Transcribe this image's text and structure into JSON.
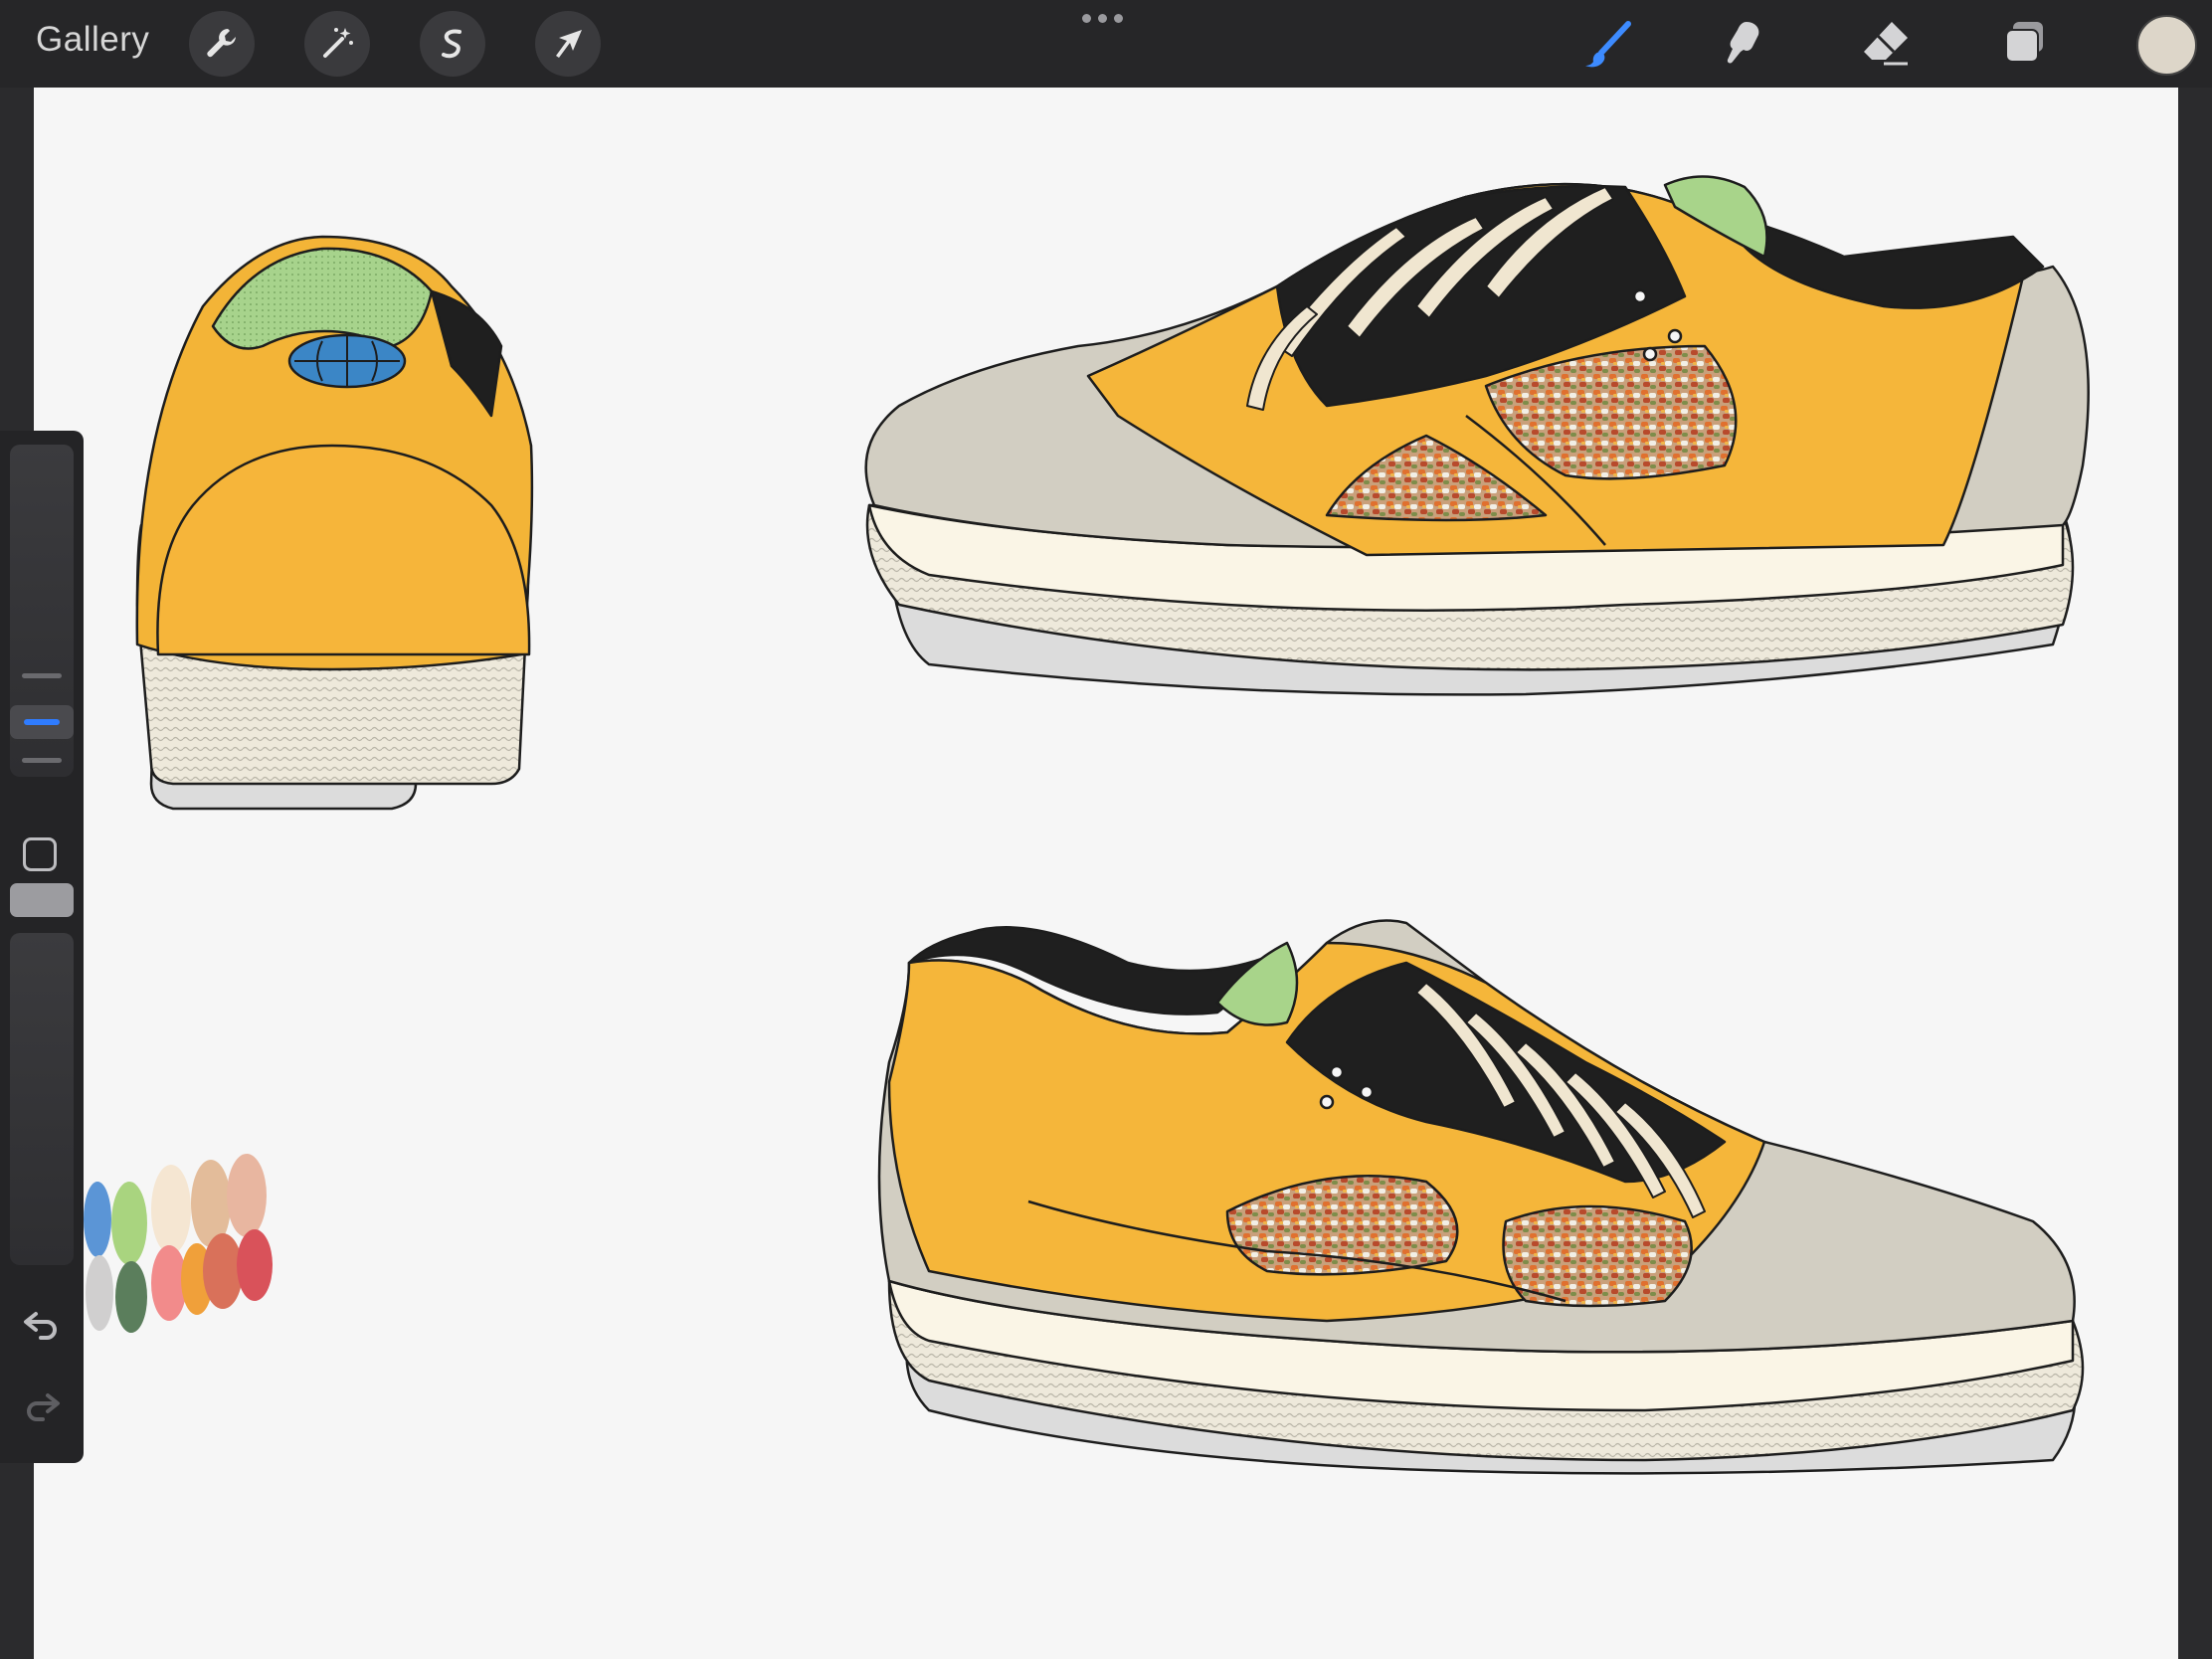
{
  "topbar": {
    "gallery_label": "Gallery",
    "left_tools": [
      "wrench-icon",
      "magic-wand-icon",
      "selection-icon",
      "transform-arrow-icon"
    ],
    "right_tools": [
      "brush-icon",
      "smudge-icon",
      "eraser-icon",
      "layers-icon"
    ],
    "active_tool": "brush-icon",
    "current_color": "#ddd6c9",
    "accent_color": "#2f7cff"
  },
  "sidebar": {
    "brush_size_slider": "brush-size",
    "opacity_slider": "opacity",
    "modifier": "square-modifier-icon",
    "undo": "undo-icon",
    "redo": "redo-icon"
  },
  "canvas": {
    "artwork": "sneaker-sketch",
    "palette_colors": [
      "#5b95d6",
      "#a9d47f",
      "#f5e6d2",
      "#e3bc9a",
      "#e8b6a0",
      "#d0cfcf",
      "#5b7e5c",
      "#f28b8b",
      "#f0a03a",
      "#d9715a",
      "#d9525a"
    ]
  }
}
